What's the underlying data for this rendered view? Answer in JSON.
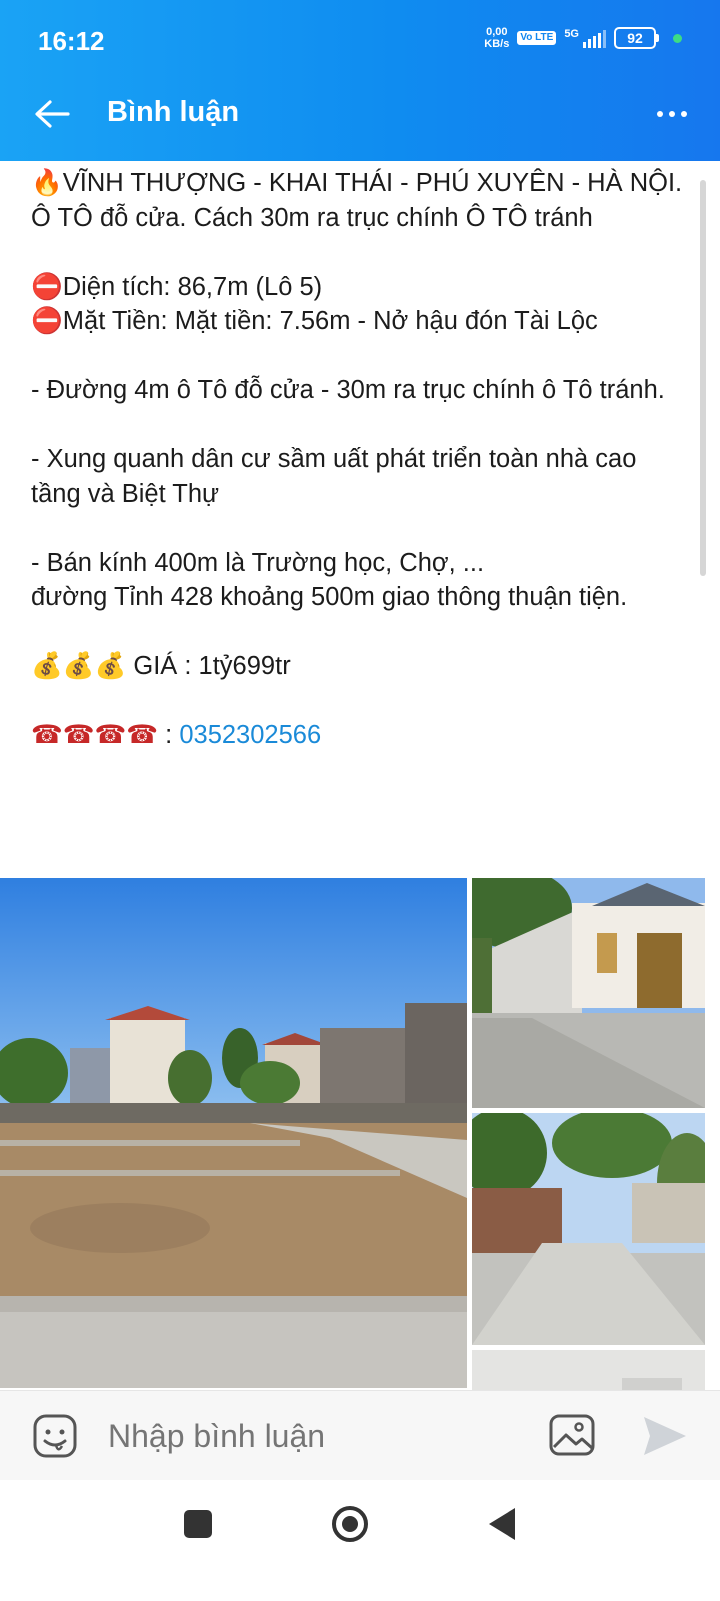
{
  "status_bar": {
    "time": "16:12",
    "net_speed_value": "0,00",
    "net_speed_unit": "KB/s",
    "volte": "Vo LTE",
    "network": "5G",
    "battery": "92"
  },
  "app_bar": {
    "title": "Bình luận",
    "back_icon": "arrow-left-icon",
    "more_icon": "more-dots-icon"
  },
  "post": {
    "headline": "VĨNH THƯỢNG - KHAI THÁI - PHÚ XUYÊN - HÀ NỘI. Ô TÔ đỗ cửa. Cách 30m ra trục chính Ô TÔ tránh",
    "area": "Diện tích: 86,7m (Lô 5)",
    "frontage": "Mặt Tiền: Mặt tiền: 7.56m - Nở hậu đón Tài Lộc",
    "road": "- Đường 4m ô Tô đỗ cửa - 30m ra trục chính ô Tô tránh.",
    "surroundings": "- Xung quanh dân cư sầm uất phát triển toàn nhà cao tầng và Biệt Thự",
    "radius": "- Bán kính 400m là Trường học, Chợ, ...",
    "province_road": "đường Tỉnh 428 khoảng 500m giao thông thuận tiện.",
    "price": "GIÁ : 1tỷ699tr",
    "phone_prefix": " : ",
    "phone": "0352302566",
    "emoji": {
      "fire": "🔥",
      "no_entry": "⛔",
      "money": "💰💰💰",
      "phone": "☎☎☎☎"
    }
  },
  "comment_bar": {
    "placeholder": "Nhập bình luận",
    "sticker_icon": "sticker-smile-icon",
    "image_icon": "image-gallery-icon",
    "send_icon": "send-arrow-icon"
  },
  "colors": {
    "header_start": "#1aa3f5",
    "header_end": "#1677ee",
    "link": "#1a8ad8",
    "placeholder": "#8a8a8a"
  }
}
